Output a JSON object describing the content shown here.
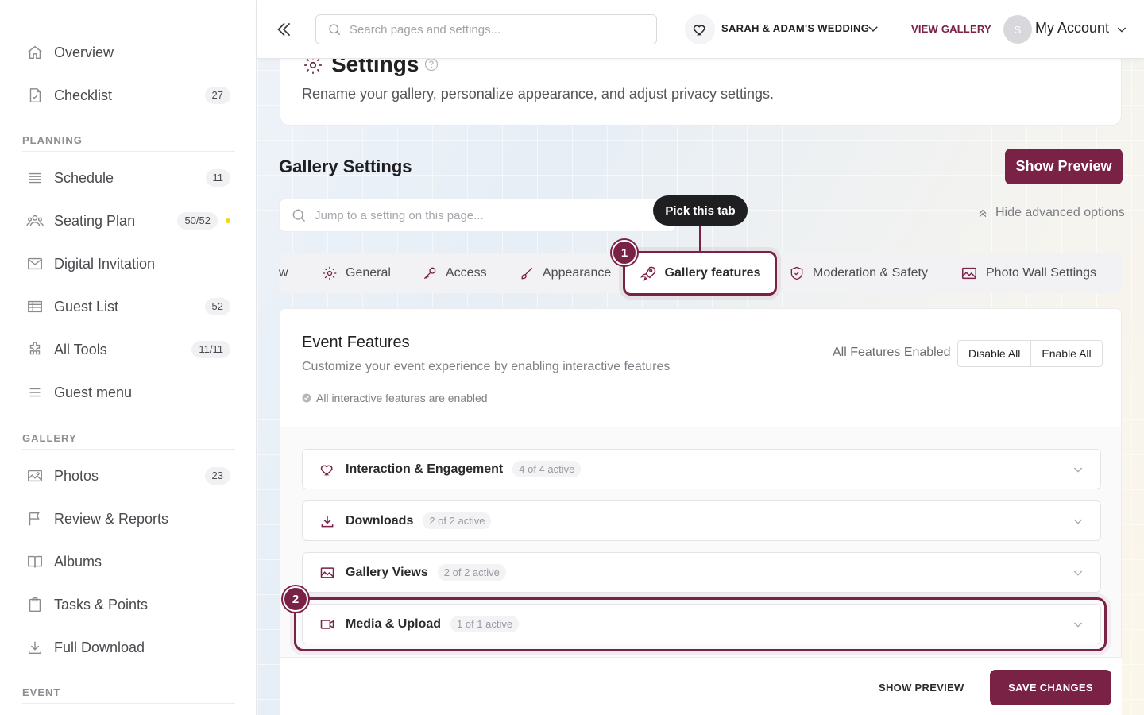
{
  "colors": {
    "accent": "#7a2146",
    "badge_dot": "#f5d90a",
    "sidebar_bg": "#ffffff"
  },
  "sidebar": {
    "top_items": [
      {
        "label": "Overview",
        "icon": "home-icon"
      },
      {
        "label": "Checklist",
        "icon": "checklist-icon",
        "badge": "27"
      }
    ],
    "planning": {
      "label": "PLANNING",
      "items": [
        {
          "label": "Schedule",
          "icon": "list-icon",
          "badge": "11"
        },
        {
          "label": "Seating Plan",
          "icon": "people-icon",
          "badge": "50/52",
          "dot": true
        },
        {
          "label": "Digital Invitation",
          "icon": "envelope-icon"
        },
        {
          "label": "Guest List",
          "icon": "table-icon",
          "badge": "52"
        },
        {
          "label": "All Tools",
          "icon": "puzzle-icon",
          "badge": "11/11"
        },
        {
          "label": "Guest menu",
          "icon": "menu-icon"
        }
      ]
    },
    "gallery": {
      "label": "GALLERY",
      "items": [
        {
          "label": "Photos",
          "icon": "image-icon",
          "badge": "23"
        },
        {
          "label": "Review & Reports",
          "icon": "flag-icon"
        },
        {
          "label": "Albums",
          "icon": "book-icon"
        },
        {
          "label": "Tasks & Points",
          "icon": "clipboard-icon"
        },
        {
          "label": "Full Download",
          "icon": "download-icon"
        }
      ]
    },
    "event": {
      "label": "EVENT"
    }
  },
  "topbar": {
    "search_placeholder": "Search pages and settings...",
    "wedding_name": "SARAH & ADAM'S WEDDING",
    "view_gallery": "VIEW GALLERY",
    "avatar_initial": "S",
    "account_label": "My Account"
  },
  "header": {
    "title": "Settings",
    "description": "Rename your gallery, personalize appearance, and adjust privacy settings."
  },
  "gallery_settings": {
    "title": "Gallery Settings",
    "show_preview": "Show Preview",
    "jump_placeholder": "Jump to a setting on this page...",
    "hide_advanced": "Hide advanced options",
    "tabs": [
      {
        "label": "w",
        "icon": ""
      },
      {
        "label": "General",
        "icon": "gear-icon"
      },
      {
        "label": "Access",
        "icon": "key-icon"
      },
      {
        "label": "Appearance",
        "icon": "brush-icon"
      },
      {
        "label": "Gallery features",
        "icon": "rocket-icon",
        "active": true
      },
      {
        "label": "Moderation & Safety",
        "icon": "shield-icon"
      },
      {
        "label": "Photo Wall Settings",
        "icon": "image-icon"
      }
    ]
  },
  "callouts": {
    "tooltip": "Pick this tab",
    "step1": "1",
    "step2": "2"
  },
  "event_features": {
    "title": "Event Features",
    "subtitle": "Customize your event experience by enabling interactive features",
    "status": "All interactive features are enabled",
    "all_enabled": "All Features Enabled",
    "disable_all": "Disable All",
    "enable_all": "Enable All",
    "sections": [
      {
        "name": "Interaction & Engagement",
        "count": "4 of 4 active",
        "icon": "heart-icon"
      },
      {
        "name": "Downloads",
        "count": "2 of 2 active",
        "icon": "download-icon"
      },
      {
        "name": "Gallery Views",
        "count": "2 of 2 active",
        "icon": "image-icon"
      },
      {
        "name": "Media & Upload",
        "count": "1 of 1 active",
        "icon": "video-icon"
      }
    ]
  },
  "footer": {
    "show_preview": "SHOW PREVIEW",
    "save_changes": "SAVE CHANGES"
  }
}
